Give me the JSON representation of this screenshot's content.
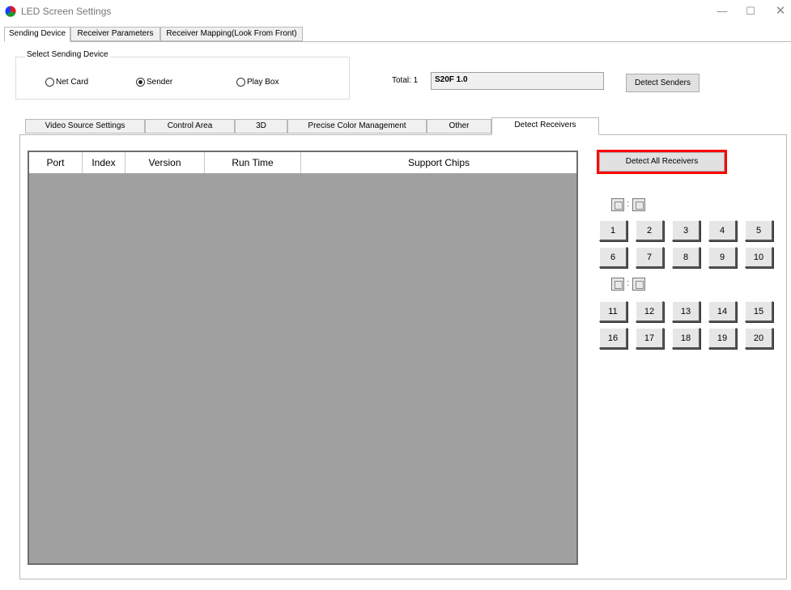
{
  "window": {
    "title": "LED Screen Settings",
    "minimize": "—",
    "maximize": "☐",
    "close": "✕"
  },
  "top_tabs": [
    {
      "label": "Sending Device",
      "active": true
    },
    {
      "label": "Receiver Parameters",
      "active": false
    },
    {
      "label": "Receiver Mapping(Look From Front)",
      "active": false
    }
  ],
  "sending_device": {
    "group_label": "Select Sending Device",
    "options": [
      {
        "label": "Net Card",
        "selected": false
      },
      {
        "label": "Sender",
        "selected": true
      },
      {
        "label": "Play Box",
        "selected": false
      }
    ],
    "total_label": "Total:  1",
    "device_value": "S20F 1.0",
    "detect_senders_label": "Detect Senders"
  },
  "inner_tabs": [
    {
      "label": "Video Source Settings",
      "active": false
    },
    {
      "label": "Control Area",
      "active": false
    },
    {
      "label": "3D",
      "active": false
    },
    {
      "label": "Precise Color Management",
      "active": false
    },
    {
      "label": "Other",
      "active": false
    },
    {
      "label": "Detect Receivers",
      "active": true
    }
  ],
  "receiver_table": {
    "columns": [
      "Port",
      "Index",
      "Version",
      "Run Time",
      "Support Chips"
    ],
    "rows": []
  },
  "detect_all_label": "Detect All Receivers",
  "legend_separator": ":",
  "receiver_buttons": {
    "group1": [
      "1",
      "2",
      "3",
      "4",
      "5",
      "6",
      "7",
      "8",
      "9",
      "10"
    ],
    "group2": [
      "11",
      "12",
      "13",
      "14",
      "15",
      "16",
      "17",
      "18",
      "19",
      "20"
    ]
  },
  "icons": {
    "app": "led-color-icon",
    "legend": "screen-box-icon"
  },
  "colors": {
    "highlight": "#ff0000",
    "table_bg": "#a0a0a0"
  }
}
